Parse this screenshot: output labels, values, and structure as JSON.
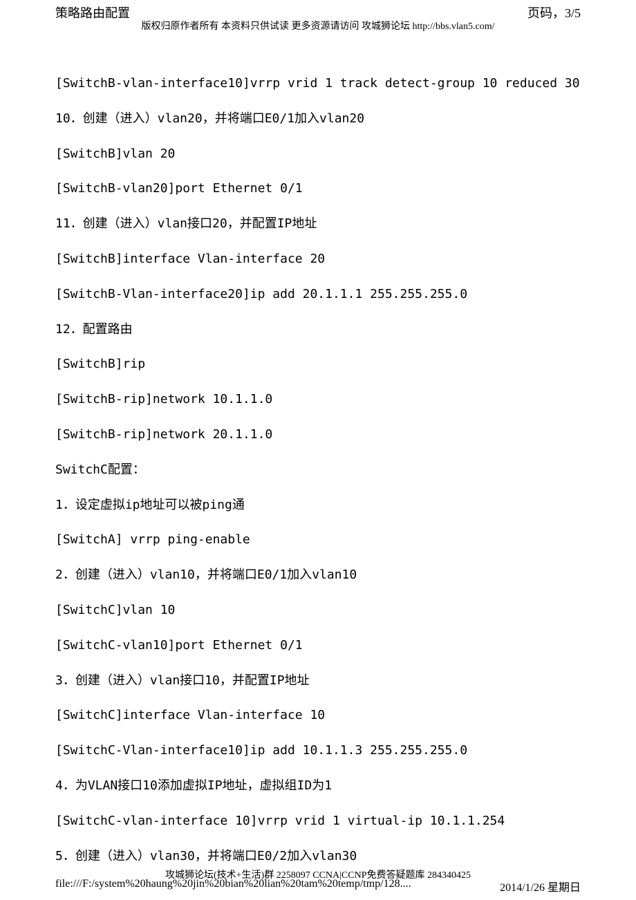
{
  "header": {
    "title": "策略路由配置",
    "pageLabel": "页码，3/5",
    "copyright": "版权归原作者所有 本资料只供试读 更多资源请访问 攻城狮论坛 http://bbs.vlan5.com/"
  },
  "content": {
    "lines": [
      "[SwitchB-vlan-interface10]vrrp vrid 1 track detect-group 10 reduced 30",
      "10．创建（进入）vlan20，并将端口E0/1加入vlan20",
      "[SwitchB]vlan 20",
      "[SwitchB-vlan20]port Ethernet 0/1",
      "11．创建（进入）vlan接口20，并配置IP地址",
      "[SwitchB]interface Vlan-interface 20",
      "[SwitchB-Vlan-interface20]ip add 20.1.1.1 255.255.255.0",
      "12．配置路由",
      "[SwitchB]rip",
      "[SwitchB-rip]network 10.1.1.0",
      "[SwitchB-rip]network 20.1.1.0",
      "SwitchC配置：",
      "1．设定虚拟ip地址可以被ping通",
      "[SwitchA] vrrp ping-enable",
      "2．创建（进入）vlan10，并将端口E0/1加入vlan10",
      "[SwitchC]vlan 10",
      "[SwitchC-vlan10]port Ethernet 0/1",
      "3．创建（进入）vlan接口10，并配置IP地址",
      "[SwitchC]interface Vlan-interface 10",
      "[SwitchC-Vlan-interface10]ip add 10.1.1.3 255.255.255.0",
      "4．为VLAN接口10添加虚拟IP地址，虚拟组ID为1",
      "[SwitchC-vlan-interface 10]vrrp vrid 1 virtual-ip 10.1.1.254",
      "5．创建（进入）vlan30，并将端口E0/2加入vlan30"
    ]
  },
  "footer": {
    "groupInfo": "攻城狮论坛(技术+生活)群 2258097 CCNA|CCNP免费答疑题库 284340425",
    "filePath": "file:///F:/system%20haung%20jin%20bian%20lian%20tam%20temp/tmp/128....",
    "date": "2014/1/26 星期日"
  }
}
